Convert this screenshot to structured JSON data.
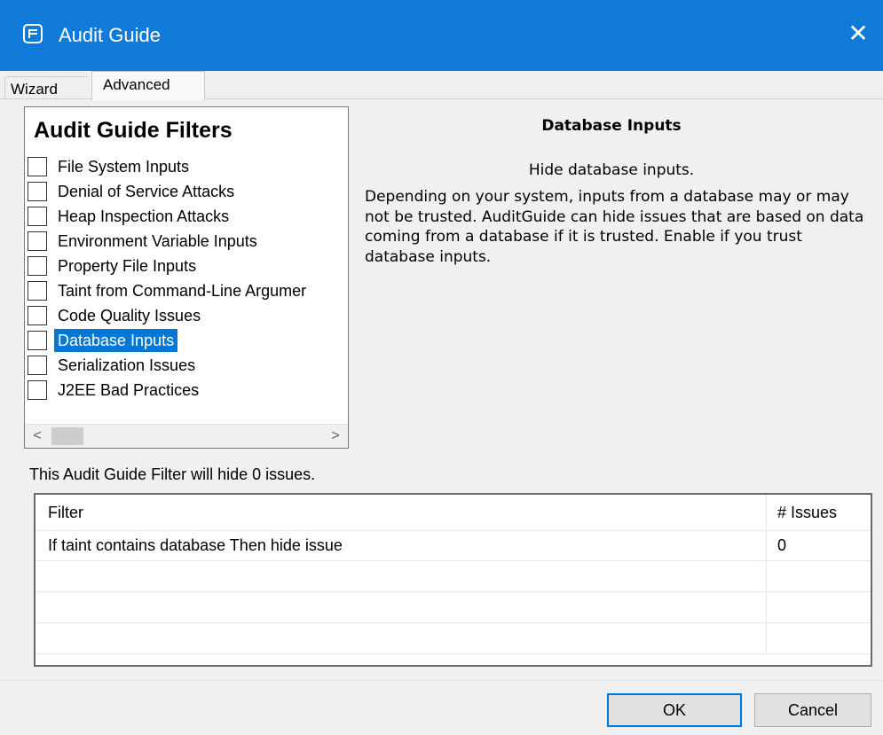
{
  "window": {
    "title": "Audit Guide",
    "close_symbol": "✕",
    "app_icon": "fortify-icon",
    "accent_color": "#0f7ad8"
  },
  "tabs": [
    {
      "label": "Wizard"
    },
    {
      "label": "Advanced",
      "active": true
    }
  ],
  "filters": {
    "heading": "Audit Guide Filters",
    "items": [
      {
        "label": "File System Inputs",
        "checked": false
      },
      {
        "label": "Denial of Service Attacks",
        "checked": false
      },
      {
        "label": "Heap Inspection Attacks",
        "checked": false
      },
      {
        "label": "Environment Variable Inputs",
        "checked": false
      },
      {
        "label": "Property File Inputs",
        "checked": false
      },
      {
        "label": "Taint from Command-Line Argumer",
        "checked": false
      },
      {
        "label": "Code Quality Issues",
        "checked": false
      },
      {
        "label": "Database Inputs",
        "checked": false,
        "selected": true
      },
      {
        "label": "Serialization Issues",
        "checked": false
      },
      {
        "label": "J2EE Bad Practices",
        "checked": false
      }
    ],
    "scroll_left": "<",
    "scroll_right": ">"
  },
  "description": {
    "title": "Database Inputs",
    "subtitle": "Hide database inputs.",
    "body": "Depending on your system, inputs from a database may or may not be trusted. AuditGuide can hide issues that are based on data coming from a database if it is trusted. Enable if you trust database inputs."
  },
  "hide_count_text": "This Audit Guide Filter will hide 0 issues.",
  "table": {
    "columns": [
      "Filter",
      "# Issues"
    ],
    "rows": [
      [
        "If taint contains database Then hide issue",
        "0"
      ],
      [
        "",
        ""
      ],
      [
        "",
        ""
      ],
      [
        "",
        ""
      ]
    ]
  },
  "buttons": {
    "ok": "OK",
    "cancel": "Cancel"
  }
}
